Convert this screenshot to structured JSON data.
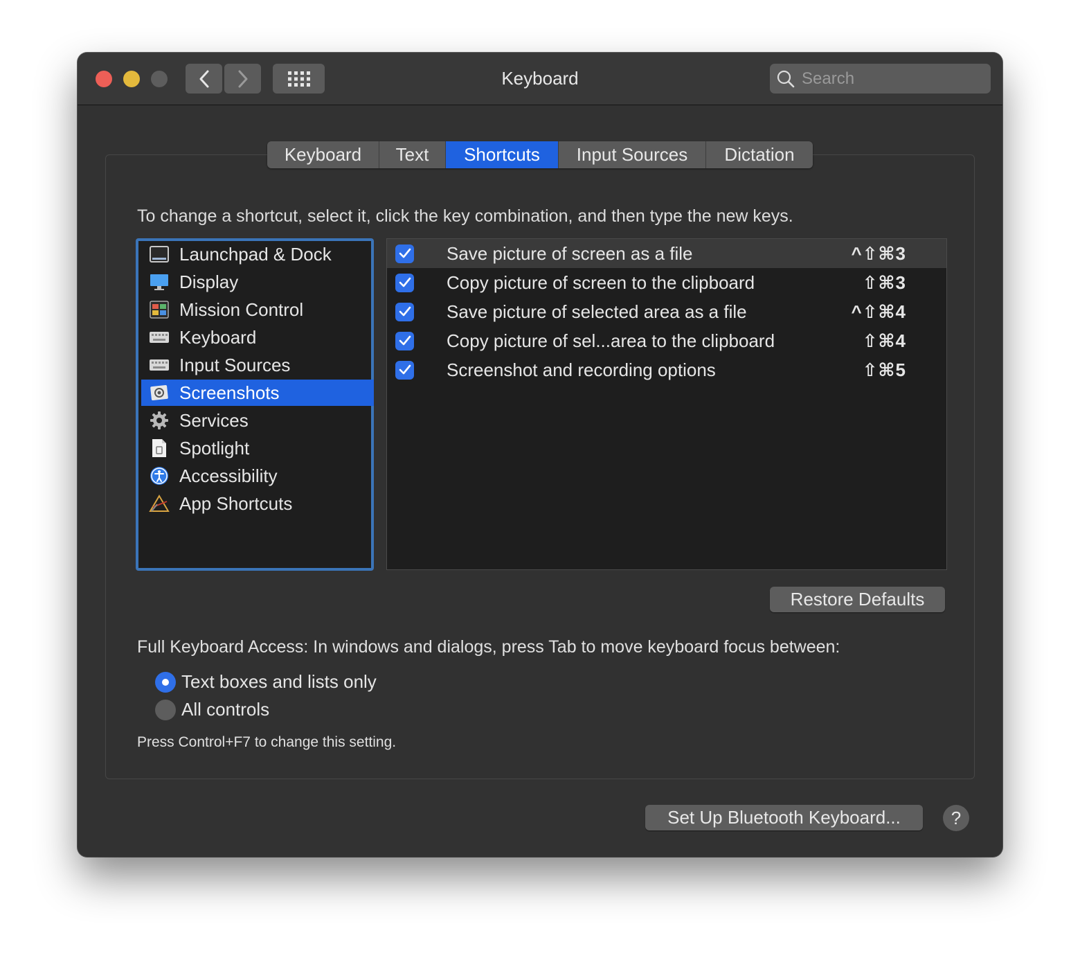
{
  "window": {
    "title": "Keyboard"
  },
  "toolbar": {
    "back_icon": "chevron-left-icon",
    "forward_icon": "chevron-right-icon",
    "grid_icon": "grid-icon"
  },
  "search": {
    "placeholder": "Search"
  },
  "tabs": [
    {
      "label": "Keyboard",
      "active": false
    },
    {
      "label": "Text",
      "active": false
    },
    {
      "label": "Shortcuts",
      "active": true
    },
    {
      "label": "Input Sources",
      "active": false
    },
    {
      "label": "Dictation",
      "active": false
    }
  ],
  "instructions": "To change a shortcut, select it, click the key combination, and then type the new keys.",
  "categories": [
    {
      "label": "Launchpad & Dock",
      "icon": "dock-icon"
    },
    {
      "label": "Display",
      "icon": "display-icon"
    },
    {
      "label": "Mission Control",
      "icon": "mission-control-icon"
    },
    {
      "label": "Keyboard",
      "icon": "keyboard-icon"
    },
    {
      "label": "Input Sources",
      "icon": "keyboard-icon"
    },
    {
      "label": "Screenshots",
      "icon": "screenshot-icon",
      "selected": true
    },
    {
      "label": "Services",
      "icon": "gear-icon"
    },
    {
      "label": "Spotlight",
      "icon": "document-icon"
    },
    {
      "label": "Accessibility",
      "icon": "accessibility-icon"
    },
    {
      "label": "App Shortcuts",
      "icon": "app-store-icon"
    }
  ],
  "shortcuts": [
    {
      "label": "Save picture of screen as a file",
      "keys": "^⇧⌘3",
      "checked": true
    },
    {
      "label": "Copy picture of screen to the clipboard",
      "keys": "⇧⌘3",
      "checked": true
    },
    {
      "label": "Save picture of selected area as a file",
      "keys": "^⇧⌘4",
      "checked": true
    },
    {
      "label": "Copy picture of sel...area to the clipboard",
      "keys": "⇧⌘4",
      "checked": true
    },
    {
      "label": "Screenshot and recording options",
      "keys": "⇧⌘5",
      "checked": true
    }
  ],
  "buttons": {
    "restore_defaults": "Restore Defaults",
    "bluetooth": "Set Up Bluetooth Keyboard...",
    "help": "?"
  },
  "full_keyboard_access": {
    "label": "Full Keyboard Access: In windows and dialogs, press Tab to move keyboard focus between:",
    "options": [
      {
        "label": "Text boxes and lists only",
        "selected": true
      },
      {
        "label": "All controls",
        "selected": false
      }
    ],
    "hint": "Press Control+F7 to change this setting."
  },
  "colors": {
    "accent": "#1f62e0",
    "window_bg": "#323232",
    "list_bg": "#1e1e1e"
  }
}
